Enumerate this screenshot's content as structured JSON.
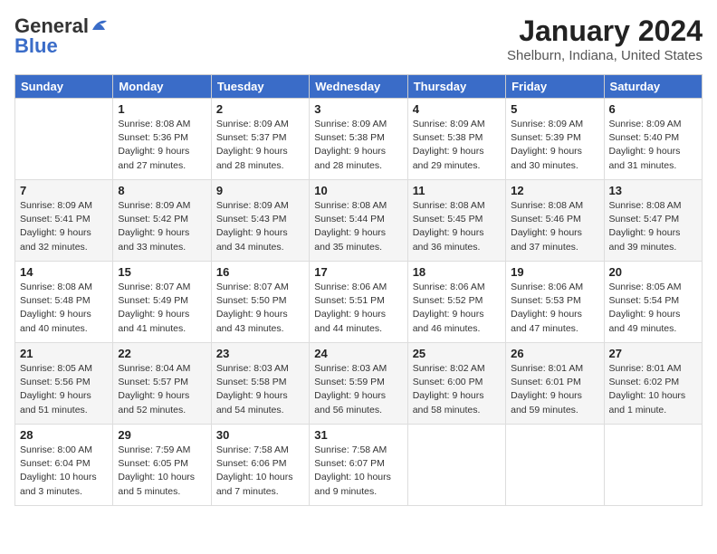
{
  "header": {
    "logo_general": "General",
    "logo_blue": "Blue",
    "month": "January 2024",
    "location": "Shelburn, Indiana, United States"
  },
  "weekdays": [
    "Sunday",
    "Monday",
    "Tuesday",
    "Wednesday",
    "Thursday",
    "Friday",
    "Saturday"
  ],
  "weeks": [
    [
      {
        "day": "",
        "sunrise": "",
        "sunset": "",
        "daylight": ""
      },
      {
        "day": "1",
        "sunrise": "Sunrise: 8:08 AM",
        "sunset": "Sunset: 5:36 PM",
        "daylight": "Daylight: 9 hours and 27 minutes."
      },
      {
        "day": "2",
        "sunrise": "Sunrise: 8:09 AM",
        "sunset": "Sunset: 5:37 PM",
        "daylight": "Daylight: 9 hours and 28 minutes."
      },
      {
        "day": "3",
        "sunrise": "Sunrise: 8:09 AM",
        "sunset": "Sunset: 5:38 PM",
        "daylight": "Daylight: 9 hours and 28 minutes."
      },
      {
        "day": "4",
        "sunrise": "Sunrise: 8:09 AM",
        "sunset": "Sunset: 5:38 PM",
        "daylight": "Daylight: 9 hours and 29 minutes."
      },
      {
        "day": "5",
        "sunrise": "Sunrise: 8:09 AM",
        "sunset": "Sunset: 5:39 PM",
        "daylight": "Daylight: 9 hours and 30 minutes."
      },
      {
        "day": "6",
        "sunrise": "Sunrise: 8:09 AM",
        "sunset": "Sunset: 5:40 PM",
        "daylight": "Daylight: 9 hours and 31 minutes."
      }
    ],
    [
      {
        "day": "7",
        "sunrise": "Sunrise: 8:09 AM",
        "sunset": "Sunset: 5:41 PM",
        "daylight": "Daylight: 9 hours and 32 minutes."
      },
      {
        "day": "8",
        "sunrise": "Sunrise: 8:09 AM",
        "sunset": "Sunset: 5:42 PM",
        "daylight": "Daylight: 9 hours and 33 minutes."
      },
      {
        "day": "9",
        "sunrise": "Sunrise: 8:09 AM",
        "sunset": "Sunset: 5:43 PM",
        "daylight": "Daylight: 9 hours and 34 minutes."
      },
      {
        "day": "10",
        "sunrise": "Sunrise: 8:08 AM",
        "sunset": "Sunset: 5:44 PM",
        "daylight": "Daylight: 9 hours and 35 minutes."
      },
      {
        "day": "11",
        "sunrise": "Sunrise: 8:08 AM",
        "sunset": "Sunset: 5:45 PM",
        "daylight": "Daylight: 9 hours and 36 minutes."
      },
      {
        "day": "12",
        "sunrise": "Sunrise: 8:08 AM",
        "sunset": "Sunset: 5:46 PM",
        "daylight": "Daylight: 9 hours and 37 minutes."
      },
      {
        "day": "13",
        "sunrise": "Sunrise: 8:08 AM",
        "sunset": "Sunset: 5:47 PM",
        "daylight": "Daylight: 9 hours and 39 minutes."
      }
    ],
    [
      {
        "day": "14",
        "sunrise": "Sunrise: 8:08 AM",
        "sunset": "Sunset: 5:48 PM",
        "daylight": "Daylight: 9 hours and 40 minutes."
      },
      {
        "day": "15",
        "sunrise": "Sunrise: 8:07 AM",
        "sunset": "Sunset: 5:49 PM",
        "daylight": "Daylight: 9 hours and 41 minutes."
      },
      {
        "day": "16",
        "sunrise": "Sunrise: 8:07 AM",
        "sunset": "Sunset: 5:50 PM",
        "daylight": "Daylight: 9 hours and 43 minutes."
      },
      {
        "day": "17",
        "sunrise": "Sunrise: 8:06 AM",
        "sunset": "Sunset: 5:51 PM",
        "daylight": "Daylight: 9 hours and 44 minutes."
      },
      {
        "day": "18",
        "sunrise": "Sunrise: 8:06 AM",
        "sunset": "Sunset: 5:52 PM",
        "daylight": "Daylight: 9 hours and 46 minutes."
      },
      {
        "day": "19",
        "sunrise": "Sunrise: 8:06 AM",
        "sunset": "Sunset: 5:53 PM",
        "daylight": "Daylight: 9 hours and 47 minutes."
      },
      {
        "day": "20",
        "sunrise": "Sunrise: 8:05 AM",
        "sunset": "Sunset: 5:54 PM",
        "daylight": "Daylight: 9 hours and 49 minutes."
      }
    ],
    [
      {
        "day": "21",
        "sunrise": "Sunrise: 8:05 AM",
        "sunset": "Sunset: 5:56 PM",
        "daylight": "Daylight: 9 hours and 51 minutes."
      },
      {
        "day": "22",
        "sunrise": "Sunrise: 8:04 AM",
        "sunset": "Sunset: 5:57 PM",
        "daylight": "Daylight: 9 hours and 52 minutes."
      },
      {
        "day": "23",
        "sunrise": "Sunrise: 8:03 AM",
        "sunset": "Sunset: 5:58 PM",
        "daylight": "Daylight: 9 hours and 54 minutes."
      },
      {
        "day": "24",
        "sunrise": "Sunrise: 8:03 AM",
        "sunset": "Sunset: 5:59 PM",
        "daylight": "Daylight: 9 hours and 56 minutes."
      },
      {
        "day": "25",
        "sunrise": "Sunrise: 8:02 AM",
        "sunset": "Sunset: 6:00 PM",
        "daylight": "Daylight: 9 hours and 58 minutes."
      },
      {
        "day": "26",
        "sunrise": "Sunrise: 8:01 AM",
        "sunset": "Sunset: 6:01 PM",
        "daylight": "Daylight: 9 hours and 59 minutes."
      },
      {
        "day": "27",
        "sunrise": "Sunrise: 8:01 AM",
        "sunset": "Sunset: 6:02 PM",
        "daylight": "Daylight: 10 hours and 1 minute."
      }
    ],
    [
      {
        "day": "28",
        "sunrise": "Sunrise: 8:00 AM",
        "sunset": "Sunset: 6:04 PM",
        "daylight": "Daylight: 10 hours and 3 minutes."
      },
      {
        "day": "29",
        "sunrise": "Sunrise: 7:59 AM",
        "sunset": "Sunset: 6:05 PM",
        "daylight": "Daylight: 10 hours and 5 minutes."
      },
      {
        "day": "30",
        "sunrise": "Sunrise: 7:58 AM",
        "sunset": "Sunset: 6:06 PM",
        "daylight": "Daylight: 10 hours and 7 minutes."
      },
      {
        "day": "31",
        "sunrise": "Sunrise: 7:58 AM",
        "sunset": "Sunset: 6:07 PM",
        "daylight": "Daylight: 10 hours and 9 minutes."
      },
      {
        "day": "",
        "sunrise": "",
        "sunset": "",
        "daylight": ""
      },
      {
        "day": "",
        "sunrise": "",
        "sunset": "",
        "daylight": ""
      },
      {
        "day": "",
        "sunrise": "",
        "sunset": "",
        "daylight": ""
      }
    ]
  ]
}
